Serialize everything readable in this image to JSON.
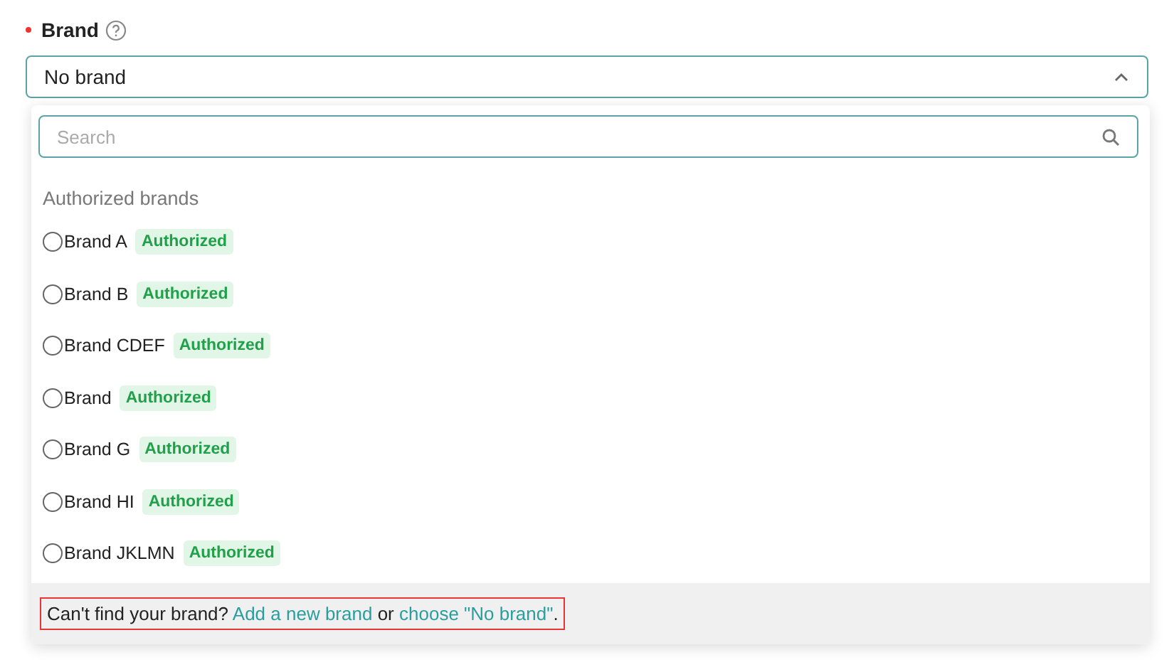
{
  "field": {
    "label": "Brand",
    "required": true,
    "value": "No brand",
    "expanded": true
  },
  "dropdown": {
    "search": {
      "placeholder": "Search"
    },
    "group_title": "Authorized brands",
    "options": [
      {
        "name": "Brand A",
        "badge": "Authorized",
        "selected": false
      },
      {
        "name": "Brand B",
        "badge": "Authorized",
        "selected": false
      },
      {
        "name": "Brand CDEF",
        "badge": "Authorized",
        "selected": false
      },
      {
        "name": "Brand",
        "badge": "Authorized",
        "selected": false
      },
      {
        "name": "Brand G",
        "badge": "Authorized",
        "selected": false
      },
      {
        "name": "Brand HI",
        "badge": "Authorized",
        "selected": false
      },
      {
        "name": "Brand JKLMN",
        "badge": "Authorized",
        "selected": false
      }
    ],
    "footer": {
      "prefix": "Can't find your brand?",
      "add_link": "Add a new brand",
      "middle": "or",
      "choose_link": "choose \"No brand\"",
      "suffix": "."
    }
  }
}
